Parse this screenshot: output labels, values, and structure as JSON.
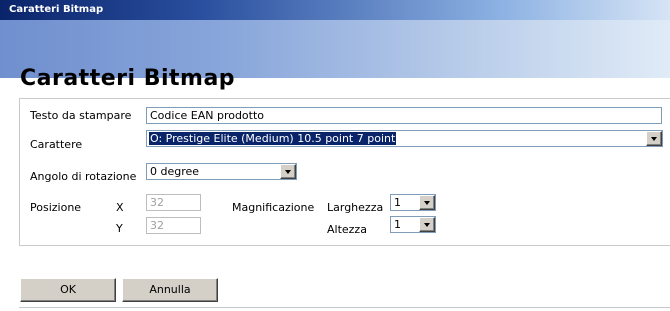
{
  "window": {
    "title": "Caratteri Bitmap"
  },
  "page": {
    "heading": "Caratteri Bitmap"
  },
  "form": {
    "text_label": "Testo da stampare",
    "text_value": "Codice EAN prodotto",
    "font_label": "Carattere",
    "font_value": "O: Prestige Elite (Medium) 10.5 point 7 point",
    "rotation_label": "Angolo di rotazione",
    "rotation_value": "0 degree",
    "position_label": "Posizione",
    "x_label": "X",
    "x_value": "32",
    "y_label": "Y",
    "y_value": "32",
    "magnification_label": "Magnificazione",
    "width_label": "Larghezza",
    "width_value": "1",
    "height_label": "Altezza",
    "height_value": "1"
  },
  "buttons": {
    "ok": "OK",
    "cancel": "Annulla"
  },
  "colors": {
    "title_bar": "#0a246a",
    "selection": "#0a246a",
    "button_face": "#d4d0c8"
  }
}
